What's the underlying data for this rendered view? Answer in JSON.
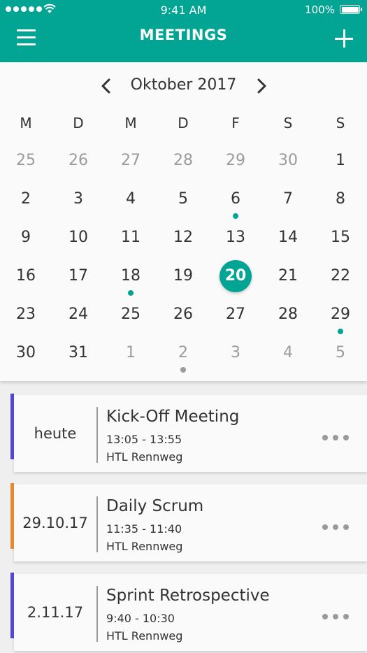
{
  "status_bar": {
    "time": "9:41 AM",
    "battery": "100%"
  },
  "header": {
    "title": "MEETINGS"
  },
  "calendar": {
    "month_label": "Oktober 2017",
    "weekdays": [
      "M",
      "D",
      "M",
      "D",
      "F",
      "S",
      "S"
    ],
    "days": [
      {
        "label": "25",
        "muted": true
      },
      {
        "label": "26",
        "muted": true
      },
      {
        "label": "27",
        "muted": true
      },
      {
        "label": "28",
        "muted": true
      },
      {
        "label": "29",
        "muted": true
      },
      {
        "label": "30",
        "muted": true
      },
      {
        "label": "1"
      },
      {
        "label": "2"
      },
      {
        "label": "3"
      },
      {
        "label": "4"
      },
      {
        "label": "5"
      },
      {
        "label": "6",
        "dot": "teal"
      },
      {
        "label": "7"
      },
      {
        "label": "8"
      },
      {
        "label": "9"
      },
      {
        "label": "10"
      },
      {
        "label": "11"
      },
      {
        "label": "12"
      },
      {
        "label": "13"
      },
      {
        "label": "14"
      },
      {
        "label": "15"
      },
      {
        "label": "16"
      },
      {
        "label": "17"
      },
      {
        "label": "18",
        "dot": "teal"
      },
      {
        "label": "19"
      },
      {
        "label": "20",
        "selected": true
      },
      {
        "label": "21"
      },
      {
        "label": "22"
      },
      {
        "label": "23"
      },
      {
        "label": "24"
      },
      {
        "label": "25"
      },
      {
        "label": "26"
      },
      {
        "label": "27"
      },
      {
        "label": "28"
      },
      {
        "label": "29",
        "dot": "teal"
      },
      {
        "label": "30"
      },
      {
        "label": "31"
      },
      {
        "label": "1",
        "muted": true
      },
      {
        "label": "2",
        "muted": true,
        "dot": "grey"
      },
      {
        "label": "3",
        "muted": true
      },
      {
        "label": "4",
        "muted": true
      },
      {
        "label": "5",
        "muted": true
      }
    ]
  },
  "meetings": [
    {
      "date": "heute",
      "title": "Kick-Off Meeting",
      "time": "13:05 - 13:55",
      "location": "HTL Rennweg",
      "accent": "#5146d6"
    },
    {
      "date": "29.10.17",
      "title": "Daily Scrum",
      "time": "11:35 - 11:40",
      "location": "HTL Rennweg",
      "accent": "#e68a2e"
    },
    {
      "date": "2.11.17",
      "title": "Sprint Retrospective",
      "time": "9:40 - 10:30",
      "location": "HTL Rennweg",
      "accent": "#5146d6"
    }
  ],
  "colors": {
    "primary": "#02a493",
    "text": "#333333",
    "muted": "#9b9b9b"
  },
  "icons": {
    "menu": "menu-icon",
    "add": "plus-icon",
    "prev": "chevron-left-icon",
    "next": "chevron-right-icon",
    "more": "more-icon"
  }
}
